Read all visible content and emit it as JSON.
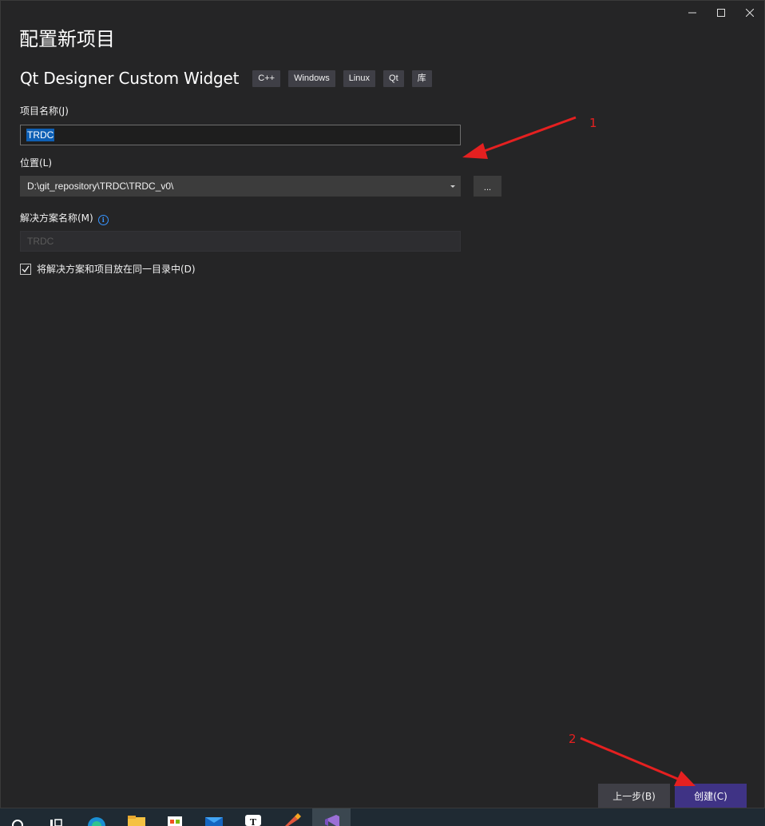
{
  "dialog": {
    "title": "配置新项目",
    "template_name": "Qt Designer Custom Widget",
    "tags": [
      "C++",
      "Windows",
      "Linux",
      "Qt",
      "库"
    ]
  },
  "window_controls": {
    "minimize_icon": "minimize-icon",
    "maximize_icon": "maximize-icon",
    "close_icon": "close-icon"
  },
  "form": {
    "project_name_label": "项目名称(J)",
    "project_name_value": "TRDC",
    "location_label": "位置(L)",
    "location_value": "D:\\git_repository\\TRDC\\TRDC_v0\\",
    "browse_label": "...",
    "solution_name_label": "解决方案名称(M)",
    "solution_name_value": "TRDC",
    "same_dir_label": "将解决方案和项目放在同一目录中(D)",
    "same_dir_checked": true
  },
  "footer": {
    "back_label": "上一步(B)",
    "create_label": "创建(C)"
  },
  "annotations": {
    "label_1": "1",
    "label_2": "2",
    "color": "#e52020"
  },
  "colors": {
    "background": "#252526",
    "accent": "#3f3385",
    "selection": "#0e5fb4"
  },
  "taskbar": {
    "icons": [
      "search-icon",
      "task-view-icon",
      "edge-icon",
      "file-explorer-icon",
      "store-icon",
      "mail-icon",
      "typora-icon",
      "tool-icon",
      "visual-studio-icon"
    ]
  }
}
